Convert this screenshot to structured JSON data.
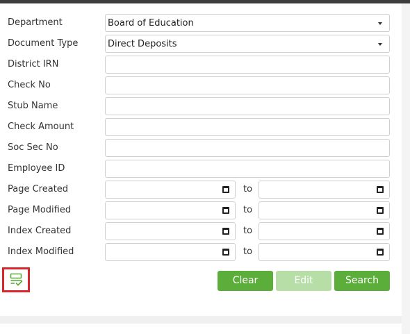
{
  "form": {
    "department": {
      "label": "Department",
      "value": "Board of Education"
    },
    "document_type": {
      "label": "Document Type",
      "value": "Direct Deposits"
    },
    "district_irn": {
      "label": "District IRN",
      "value": ""
    },
    "check_no": {
      "label": "Check No",
      "value": ""
    },
    "stub_name": {
      "label": "Stub Name",
      "value": ""
    },
    "check_amount": {
      "label": "Check Amount",
      "value": ""
    },
    "soc_sec_no": {
      "label": "Soc Sec No",
      "value": ""
    },
    "employee_id": {
      "label": "Employee ID",
      "value": ""
    },
    "page_created": {
      "label": "Page Created",
      "to": "to"
    },
    "page_modified": {
      "label": "Page Modified",
      "to": "to"
    },
    "index_created": {
      "label": "Index Created",
      "to": "to"
    },
    "index_modified": {
      "label": "Index Modified",
      "to": "to"
    }
  },
  "buttons": {
    "clear": "Clear",
    "edit": "Edit",
    "search": "Search"
  },
  "icons": {
    "highlighted": "form-check-icon",
    "calendar": "calendar-icon",
    "caret": "chevron-down-icon"
  },
  "colors": {
    "accent": "#5cae3a",
    "disabled": "#b7dea6",
    "highlight": "#d9262a"
  }
}
